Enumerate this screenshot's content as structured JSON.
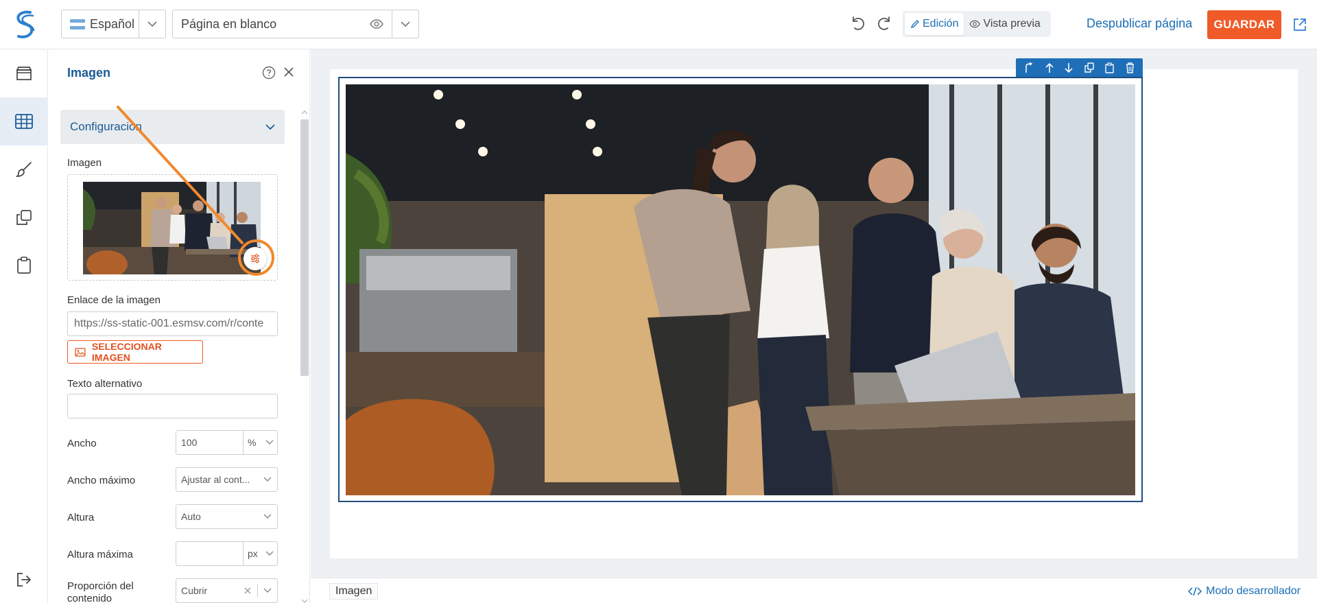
{
  "topbar": {
    "language": "Español",
    "page_name": "Página en blanco",
    "mode_edit": "Edición",
    "mode_preview": "Vista previa",
    "unpublish": "Despublicar página",
    "save": "GUARDAR"
  },
  "panel": {
    "title": "Imagen",
    "accordion_label": "Configuración",
    "image_label": "Imagen",
    "link_label": "Enlace de la imagen",
    "link_value": "https://ss-static-001.esmsv.com/r/conte",
    "select_image": "SELECCIONAR IMAGEN",
    "alt_label": "Texto alternativo",
    "alt_value": "",
    "width_label": "Ancho",
    "width_value": "100",
    "width_unit": "%",
    "max_width_label": "Ancho máximo",
    "max_width_value": "Ajustar al cont...",
    "height_label": "Altura",
    "height_value": "Auto",
    "max_height_label": "Altura máxima",
    "max_height_value": "",
    "max_height_unit": "px",
    "ratio_label_1": "Proporción del",
    "ratio_label_2": "contenido",
    "ratio_value": "Cubrir"
  },
  "statusbar": {
    "breadcrumb": "Imagen",
    "dev_mode": "Modo desarrollador"
  },
  "colors": {
    "accent": "#1a6db5",
    "brand_orange": "#f05a28",
    "highlight_orange": "#f0892e",
    "block_blue": "#1f6fb8"
  }
}
